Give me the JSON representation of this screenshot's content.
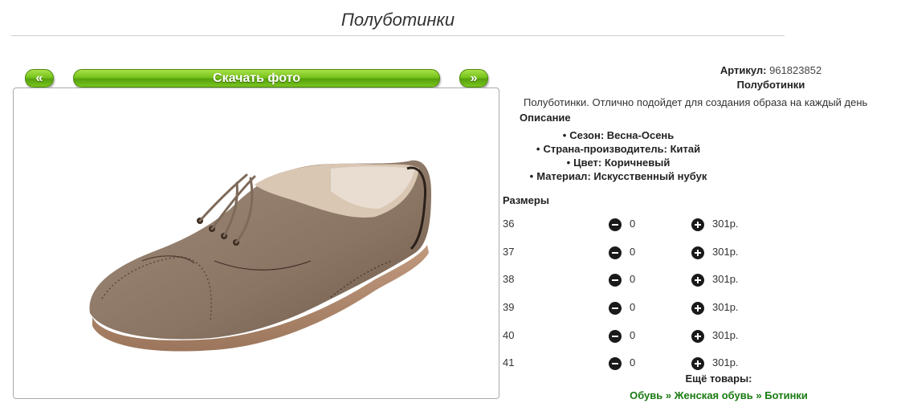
{
  "page": {
    "title": "Полуботинки"
  },
  "gallery": {
    "prev_label": "«",
    "download_label": "Скачать фото",
    "next_label": "»"
  },
  "product": {
    "article_label": "Артикул:",
    "article_value": "961823852",
    "name": "Полуботинки",
    "description": "Полуботинки. Отлично подойдет для создания образа на каждый день",
    "description_heading": "Описание",
    "attributes": [
      "Сезон: Весна-Осень",
      "Страна-производитель: Китай",
      "Цвет: Коричневый",
      "Материал: Искусственный нубук"
    ]
  },
  "sizes": {
    "heading": "Размеры",
    "rows": [
      {
        "size": "36",
        "qty": "0",
        "price": "301р."
      },
      {
        "size": "37",
        "qty": "0",
        "price": "301р."
      },
      {
        "size": "38",
        "qty": "0",
        "price": "301р."
      },
      {
        "size": "39",
        "qty": "0",
        "price": "301р."
      },
      {
        "size": "40",
        "qty": "0",
        "price": "301р."
      },
      {
        "size": "41",
        "qty": "0",
        "price": "301р."
      }
    ]
  },
  "more": {
    "heading": "Ещё товары:",
    "breadcrumbs": [
      "Обувь",
      "Женская обувь",
      "Ботинки"
    ],
    "separator": "»"
  },
  "colors": {
    "accent_green": "#78c41c",
    "link_green": "#1a7a12",
    "shoe_brown": "#8a7463"
  },
  "icons": {
    "minus": "minus-circle-icon",
    "plus": "plus-circle-icon"
  }
}
